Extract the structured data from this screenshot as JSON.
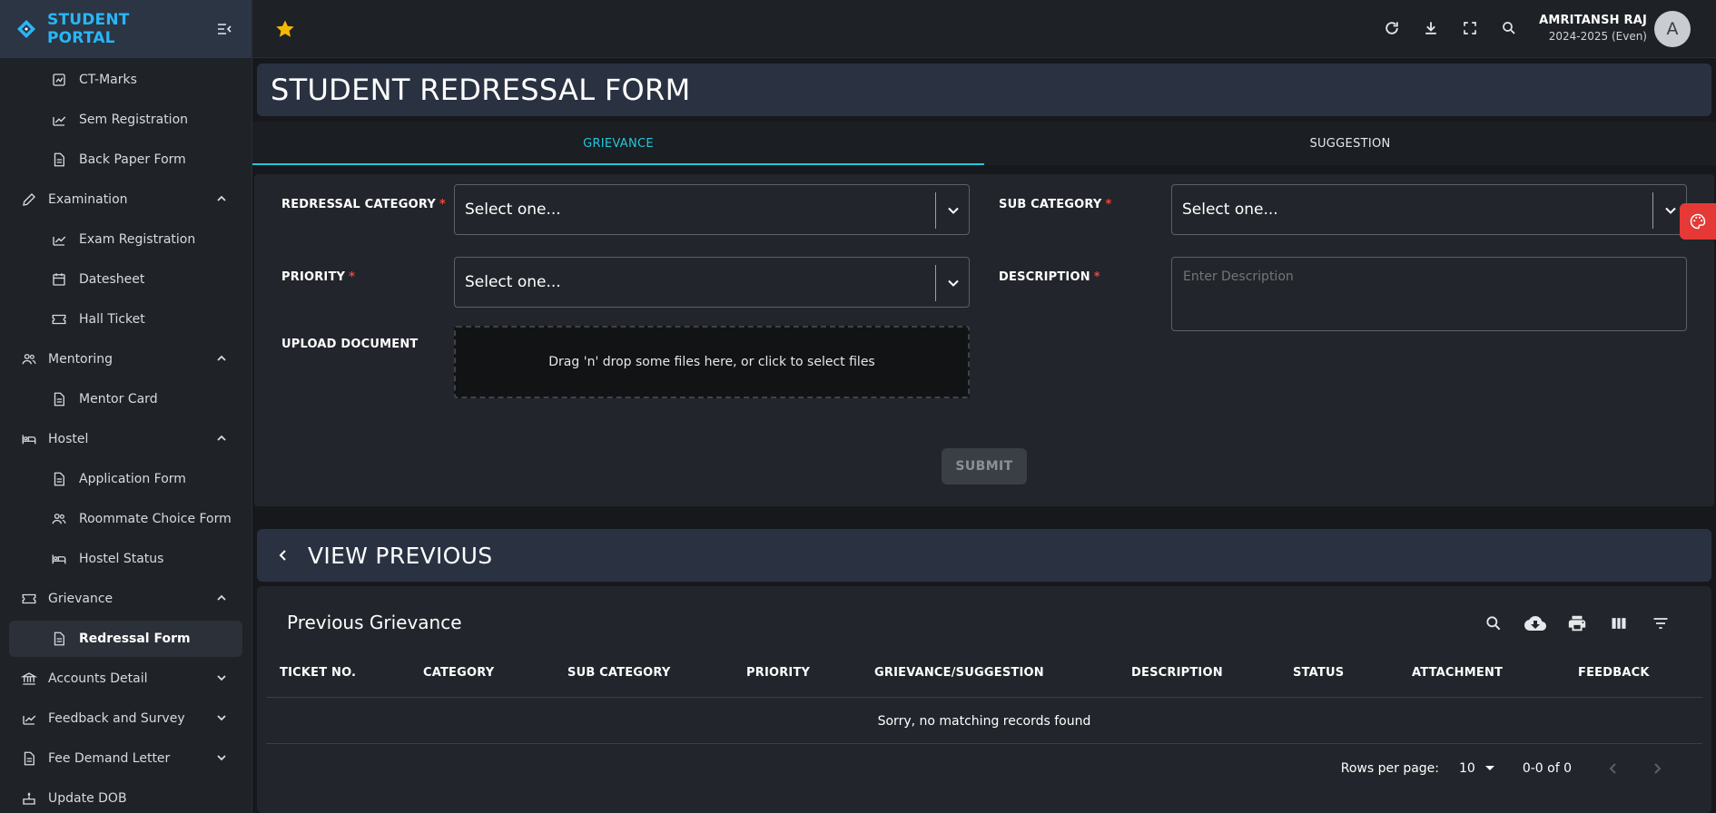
{
  "brand": {
    "name": "STUDENT PORTAL"
  },
  "sidebar": {
    "items": [
      {
        "label": "CT-Marks",
        "level": "child",
        "icon": "assessment-icon"
      },
      {
        "label": "Sem Registration",
        "level": "child",
        "icon": "edit-chart-icon"
      },
      {
        "label": "Back Paper Form",
        "level": "child",
        "icon": "document-icon"
      },
      {
        "label": "Examination",
        "level": "parent",
        "icon": "pencil-icon",
        "expanded": true
      },
      {
        "label": "Exam Registration",
        "level": "child",
        "icon": "edit-chart-icon"
      },
      {
        "label": "Datesheet",
        "level": "child",
        "icon": "calendar-icon"
      },
      {
        "label": "Hall Ticket",
        "level": "child",
        "icon": "ticket-icon"
      },
      {
        "label": "Mentoring",
        "level": "parent",
        "icon": "people-icon",
        "expanded": true
      },
      {
        "label": "Mentor Card",
        "level": "child",
        "icon": "document-icon"
      },
      {
        "label": "Hostel",
        "level": "parent",
        "icon": "bed-icon",
        "expanded": true
      },
      {
        "label": "Application Form",
        "level": "child",
        "icon": "document-icon"
      },
      {
        "label": "Roommate Choice Form",
        "level": "child",
        "icon": "people-icon"
      },
      {
        "label": "Hostel Status",
        "level": "child",
        "icon": "bed-icon"
      },
      {
        "label": "Grievance",
        "level": "parent",
        "icon": "ticket-icon",
        "expanded": true
      },
      {
        "label": "Redressal Form",
        "level": "child",
        "icon": "document-icon",
        "active": true
      },
      {
        "label": "Accounts Detail",
        "level": "parent",
        "icon": "bank-icon",
        "expanded": false
      },
      {
        "label": "Feedback and Survey",
        "level": "parent",
        "icon": "edit-chart-icon",
        "expanded": false
      },
      {
        "label": "Fee Demand Letter",
        "level": "parent",
        "icon": "document-icon",
        "expanded": false
      },
      {
        "label": "Update DOB",
        "level": "parent",
        "icon": "cake-icon"
      }
    ]
  },
  "user": {
    "name": "AMRITANSH RAJ",
    "session": "2024-2025 (Even)",
    "avatar_letter": "A"
  },
  "page": {
    "title": "STUDENT REDRESSAL FORM"
  },
  "tabs": [
    {
      "label": "GRIEVANCE",
      "active": true
    },
    {
      "label": "SUGGESTION",
      "active": false
    }
  ],
  "form": {
    "redressal_category_label": "REDRESSAL CATEGORY",
    "sub_category_label": "SUB CATEGORY",
    "priority_label": "PRIORITY",
    "description_label": "DESCRIPTION",
    "upload_label": "UPLOAD DOCUMENT",
    "select_placeholder": "Select one...",
    "description_placeholder": "Enter Description",
    "dropzone_text": "Drag 'n' drop some files here, or click to select files",
    "submit_label": "SUBMIT",
    "required_mark": "*"
  },
  "previous": {
    "section_title": "VIEW PREVIOUS",
    "table_title": "Previous Grievance",
    "columns": [
      "TICKET NO.",
      "CATEGORY",
      "SUB CATEGORY",
      "PRIORITY",
      "GRIEVANCE/SUGGESTION",
      "DESCRIPTION",
      "STATUS",
      "ATTACHMENT",
      "FEEDBACK"
    ],
    "empty_text": "Sorry, no matching records found",
    "rows_per_page_label": "Rows per page:",
    "rows_per_page": "10",
    "range": "0-0 of 0"
  },
  "colors": {
    "accent": "#26c6da",
    "brand": "#29b6f6",
    "required": "#f44336",
    "star": "#f5b800",
    "palette_button": "#e53935"
  }
}
